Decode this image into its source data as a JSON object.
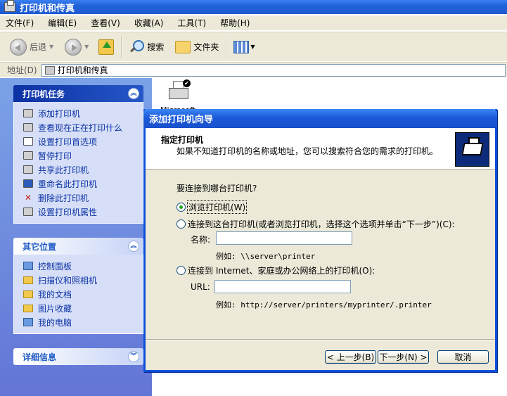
{
  "window": {
    "title": "打印机和传真"
  },
  "menubar": {
    "items": [
      "文件(F)",
      "编辑(E)",
      "查看(V)",
      "收藏(A)",
      "工具(T)",
      "帮助(H)"
    ]
  },
  "toolbar": {
    "back_label": "后退",
    "search_label": "搜索",
    "folders_label": "文件夹"
  },
  "address": {
    "label": "地址(D)",
    "value": "打印机和传真"
  },
  "tasks": {
    "printer_tasks": {
      "title": "打印机任务",
      "items": [
        {
          "label": "添加打印机",
          "icon": "add-printer-icon"
        },
        {
          "label": "查看现在正在打印什么",
          "icon": "printer-queue-icon"
        },
        {
          "label": "设置打印首选项",
          "icon": "preferences-icon"
        },
        {
          "label": "暂停打印",
          "icon": "pause-printer-icon"
        },
        {
          "label": "共享此打印机",
          "icon": "share-printer-icon"
        },
        {
          "label": "重命名此打印机",
          "icon": "rename-icon"
        },
        {
          "label": "删除此打印机",
          "icon": "delete-icon"
        },
        {
          "label": "设置打印机属性",
          "icon": "properties-icon"
        }
      ]
    },
    "other_places": {
      "title": "其它位置",
      "items": [
        {
          "label": "控制面板",
          "icon": "control-panel-icon"
        },
        {
          "label": "扫描仪和照相机",
          "icon": "scanner-icon"
        },
        {
          "label": "我的文档",
          "icon": "folder-icon"
        },
        {
          "label": "图片收藏",
          "icon": "pictures-icon"
        },
        {
          "label": "我的电脑",
          "icon": "computer-icon"
        }
      ]
    },
    "details": {
      "title": "详细信息"
    }
  },
  "content": {
    "printer_caption": "Microsoft"
  },
  "wizard": {
    "title": "添加打印机向导",
    "header_title": "指定打印机",
    "header_subtitle": "如果不知道打印机的名称或地址，您可以搜索符合您的需求的打印机。",
    "question": "要连接到哪台打印机?",
    "option_browse": "浏览打印机(W)",
    "option_connect": "连接到这台打印机(或者浏览打印机，选择这个选项并单击“下一步”)(C):",
    "name_label": "名称:",
    "name_value": "",
    "name_example": "例如: \\\\server\\printer",
    "option_internet": "连接到 Internet、家庭或办公网络上的打印机(O):",
    "url_label": "URL:",
    "url_value": "",
    "url_example": "例如: http://server/printers/myprinter/.printer",
    "selected_option": "browse",
    "back_button": "< 上一步(B)",
    "next_button": "下一步(N) >",
    "cancel_button": "取消"
  }
}
